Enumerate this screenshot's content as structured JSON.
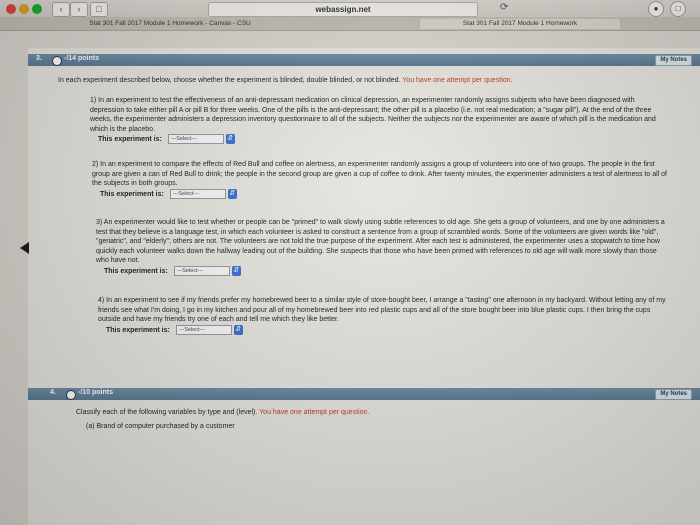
{
  "browser": {
    "url": "webassign.net",
    "tabs": [
      "Stat 301 Fall 2017 Module 1 Homework - Canvas - CSU",
      "Stat 301 Fall 2017 Module 1 Homework"
    ]
  },
  "q3": {
    "number": "3.",
    "points": "-/14 points",
    "notes": "My Notes",
    "intro": "In each experiment described below, choose whether the experiment is blinded, double blinded, or not blinded.",
    "attempt": "You have one attempt per question.",
    "items": [
      {
        "text": "1) In an experiment to test the effectiveness of an anti-depressant medication on clinical depression, an experimenter randomly assigns subjects who have been diagnosed with depression to take either pill A or pill B for three weeks. One of the pills is the anti-depressant; the other pill is a placebo (i.e. not real medication; a \"sugar pill\"). At the end of the three weeks, the experimenter administers a depression inventory questionnaire to all of the subjects. Neither the subjects nor the experimenter are aware of which pill is the medication and which is the placebo.",
        "label": "This experiment is:",
        "select": "---Select---"
      },
      {
        "text": "2) In an experiment to compare the effects of Red Bull and coffee on alertness, an experimenter randomly assigns a group of volunteers into one of two groups. The people in the first group are given a can of Red Bull to drink; the people in the second group are given a cup of coffee to drink. After twenty minutes, the experimenter administers a test of alertness to all of the subjects in both groups.",
        "label": "This experiment is:",
        "select": "---Select---"
      },
      {
        "text": "3) An experimenter would like to test whether or people can be \"primed\" to walk slowly using subtle references to old age. She gets a group of volunteers, and one by one administers a test that they believe is a language test, in which each volunteer is asked to construct a sentence from a group of scrambled words. Some of the volunteers are given words like \"old\", \"geriatric\", and \"elderly\"; others are not. The volunteers are not told the true purpose of the experiment. After each test is administered, the experimenter uses a stopwatch to time how quickly each volunteer walks down the hallway leading out of the building. She suspects that those who have been primed with references to old age will walk more slowly than those who have not.",
        "label": "This experiment is:",
        "select": "---Select---"
      },
      {
        "text": "4) In an experiment to see if my friends prefer my homebrewed beer to a similar style of store-bought beer, I arrange a \"tasting\" one afternoon in my backyard. Without letting any of my friends see what I'm doing, I go in my kitchen and pour all of my homebrewed beer into red plastic cups and all of the store bought beer into blue plastic cups. I then bring the cups outside and have my friends try one of each and tell me which they like better.",
        "label": "This experiment is:",
        "select": "---Select---"
      }
    ]
  },
  "q4": {
    "number": "4.",
    "points": "-/10 points",
    "notes": "My Notes",
    "intro": "Classify each of the following variables by type and (level).",
    "attempt": "You have one attempt per question.",
    "item_a": "(a) Brand of computer purchased by a customer"
  },
  "colors": {
    "header": "#5a7890",
    "accent_red": "#c0392b",
    "select_arrow": "#3a6fd1"
  }
}
